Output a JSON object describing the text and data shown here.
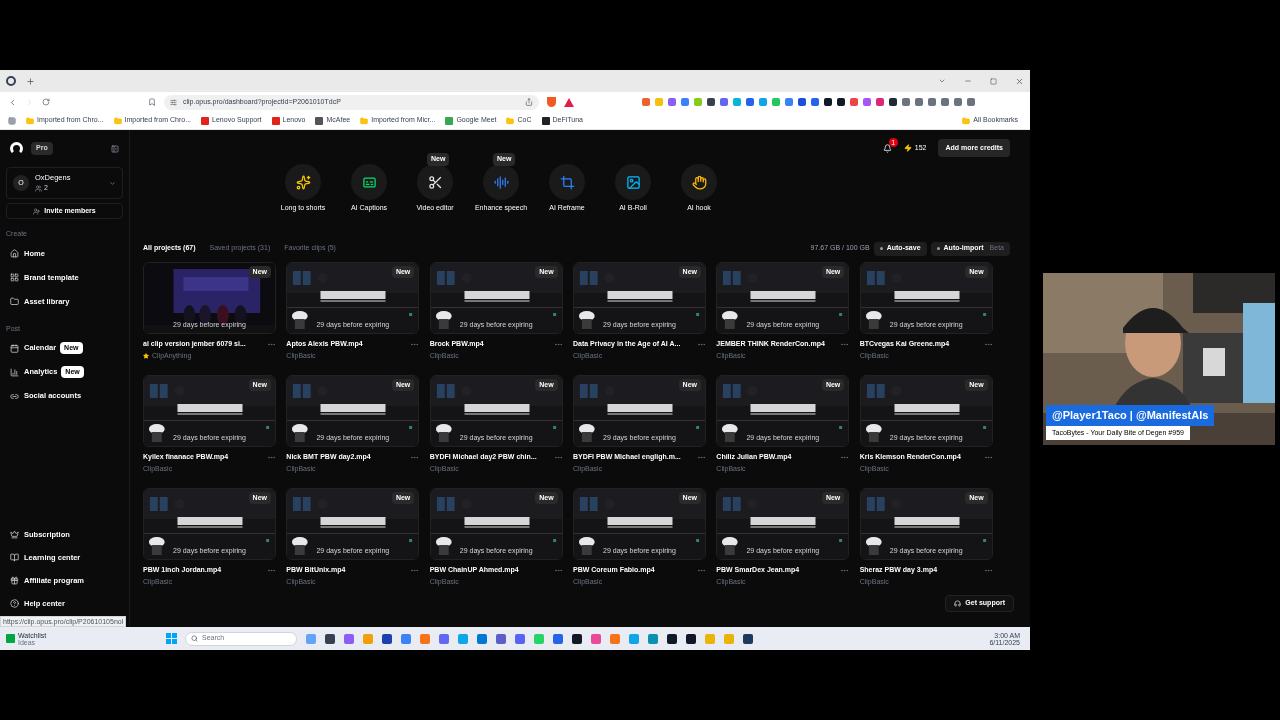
{
  "browser": {
    "address": "clip.opus.pro/dashboard?projectId=P2061010TdcP",
    "bookmarks": [
      {
        "label": "Imported from Chro...",
        "kind": "folder"
      },
      {
        "label": "Imported from Chro...",
        "kind": "folder"
      },
      {
        "label": "Lenovo Support",
        "kind": "site",
        "color": "#e2231a"
      },
      {
        "label": "Lenovo",
        "kind": "site",
        "color": "#e2231a"
      },
      {
        "label": "McAfee",
        "kind": "site",
        "color": "#555555"
      },
      {
        "label": "Imported from Micr...",
        "kind": "folder"
      },
      {
        "label": "Google Meet",
        "kind": "site",
        "color": "#34a853"
      },
      {
        "label": "CoC",
        "kind": "folder"
      },
      {
        "label": "DeFiTuna",
        "kind": "site",
        "color": "#222222"
      }
    ],
    "all_bookmarks": "All Bookmarks",
    "status_url": "https://clip.opus.pro/clip/P20610105nol"
  },
  "sidebar": {
    "plan": "Pro",
    "workspace": {
      "avatar": "O",
      "name": "OxDegens",
      "members": "2"
    },
    "invite": "Invite members",
    "sections": [
      {
        "title": "Create",
        "items": [
          {
            "label": "Home"
          },
          {
            "label": "Brand template"
          },
          {
            "label": "Asset library"
          }
        ]
      },
      {
        "title": "Post",
        "items": [
          {
            "label": "Calendar",
            "badge": "New"
          },
          {
            "label": "Analytics",
            "badge": "New"
          },
          {
            "label": "Social accounts"
          }
        ]
      }
    ],
    "bottom_items": [
      {
        "label": "Subscription"
      },
      {
        "label": "Learning center"
      },
      {
        "label": "Affiliate program"
      },
      {
        "label": "Help center"
      }
    ]
  },
  "header": {
    "notification_count": "1",
    "credits": "152",
    "add_credits": "Add more credits"
  },
  "tools": [
    {
      "label": "Long to shorts"
    },
    {
      "label": "AI Captions"
    },
    {
      "label": "Video editor",
      "badge": "New"
    },
    {
      "label": "Enhance speech",
      "badge": "New"
    },
    {
      "label": "AI Reframe"
    },
    {
      "label": "AI B-Roll"
    },
    {
      "label": "AI hook"
    }
  ],
  "tabs": [
    {
      "label": "All projects (67)",
      "selected": true
    },
    {
      "label": "Saved projects (31)",
      "selected": false
    },
    {
      "label": "Favorite clips (5)",
      "selected": false
    }
  ],
  "storage": "97.67 GB / 100 GB",
  "auto_save": "Auto-save",
  "auto_import": "Auto-import",
  "beta": "Beta",
  "projects": [
    {
      "title": "ai clip version jember 6079 si...",
      "source": "ClipAnything",
      "kind": "anything",
      "badge": "New",
      "expiry": "29 days before expiring"
    },
    {
      "title": "Aptos Alexis PBW.mp4",
      "source": "ClipBasic",
      "kind": "basic",
      "badge": "New",
      "expiry": "29 days before expiring"
    },
    {
      "title": "Brock PBW.mp4",
      "source": "ClipBasic",
      "kind": "basic",
      "badge": "New",
      "expiry": "29 days before expiring"
    },
    {
      "title": "Data Privacy in the Age of AI A...",
      "source": "ClipBasic",
      "kind": "basic",
      "badge": "New",
      "expiry": "29 days before expiring"
    },
    {
      "title": "JEMBER THINK RenderCon.mp4",
      "source": "ClipBasic",
      "kind": "basic",
      "badge": "New",
      "expiry": "29 days before expiring"
    },
    {
      "title": "BTCvegas Kai Greene.mp4",
      "source": "ClipBasic",
      "kind": "basic",
      "badge": "New",
      "expiry": "29 days before expiring"
    },
    {
      "title": "Kyilex finanace PBW.mp4",
      "source": "ClipBasic",
      "kind": "basic",
      "badge": "New",
      "expiry": "29 days before expiring"
    },
    {
      "title": "Nick BMT PBW day2.mp4",
      "source": "ClipBasic",
      "kind": "basic",
      "badge": "New",
      "expiry": "29 days before expiring"
    },
    {
      "title": "BYDFI Michael day2 PBW chin...",
      "source": "ClipBasic",
      "kind": "basic",
      "badge": "New",
      "expiry": "29 days before expiring"
    },
    {
      "title": "BYDFI PBW Michael engligh.m...",
      "source": "ClipBasic",
      "kind": "basic",
      "badge": "New",
      "expiry": "29 days before expiring"
    },
    {
      "title": "Chiliz Julian PBW.mp4",
      "source": "ClipBasic",
      "kind": "basic",
      "badge": "New",
      "expiry": "29 days before expiring"
    },
    {
      "title": "Kris Klemson RenderCon.mp4",
      "source": "ClipBasic",
      "kind": "basic",
      "badge": "New",
      "expiry": "29 days before expiring"
    },
    {
      "title": "PBW 1inch Jordan.mp4",
      "source": "ClipBasic",
      "kind": "basic",
      "badge": "New",
      "expiry": "29 days before expiring"
    },
    {
      "title": "PBW BitUnix.mp4",
      "source": "ClipBasic",
      "kind": "basic",
      "badge": "New",
      "expiry": "29 days before expiring"
    },
    {
      "title": "PBW ChainUP Ahmed.mp4",
      "source": "ClipBasic",
      "kind": "basic",
      "badge": "New",
      "expiry": "29 days before expiring"
    },
    {
      "title": "PBW Coreum Fabio.mp4",
      "source": "ClipBasic",
      "kind": "basic",
      "badge": "New",
      "expiry": "29 days before expiring"
    },
    {
      "title": "PBW SmarDex Jean.mp4",
      "source": "ClipBasic",
      "kind": "basic",
      "badge": "New",
      "expiry": "29 days before expiring"
    },
    {
      "title": "Sheraz PBW day 3.mp4",
      "source": "ClipBasic",
      "kind": "basic",
      "badge": "New",
      "expiry": "29 days before expiring"
    }
  ],
  "support": "Get support",
  "taskbar": {
    "widget_title": "Watchlist",
    "widget_sub": "Ideas",
    "search_placeholder": "Search",
    "time": "3:00 AM",
    "date": "6/11/2025"
  },
  "overlay": {
    "handles": "@Player1Taco | @ManifestAIs",
    "tagline": "TacoBytes - Your Daily Bite of Degen #959"
  }
}
